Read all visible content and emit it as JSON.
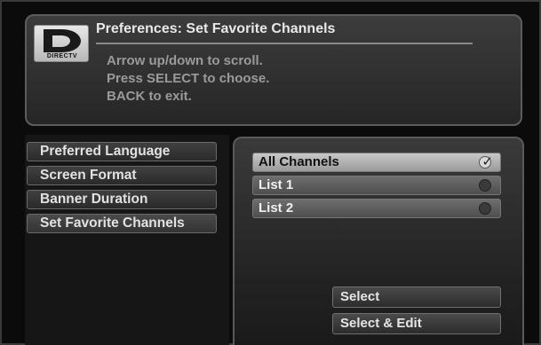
{
  "brand": {
    "logo_text": "DIRECTV"
  },
  "header": {
    "title": "Preferences: Set Favorite Channels",
    "instructions": [
      "Arrow up/down to scroll.",
      "Press SELECT to choose.",
      "BACK to exit."
    ]
  },
  "menu": {
    "items": [
      {
        "label": "Preferred Language"
      },
      {
        "label": "Screen Format"
      },
      {
        "label": "Banner Duration"
      },
      {
        "label": "Set Favorite Channels",
        "selected": true
      }
    ]
  },
  "channel_lists": {
    "items": [
      {
        "label": "All Channels",
        "selected": true
      },
      {
        "label": "List 1",
        "selected": false
      },
      {
        "label": "List 2",
        "selected": false
      }
    ],
    "check_glyph": "✓"
  },
  "actions": {
    "select_label": "Select",
    "select_edit_label": "Select & Edit"
  }
}
